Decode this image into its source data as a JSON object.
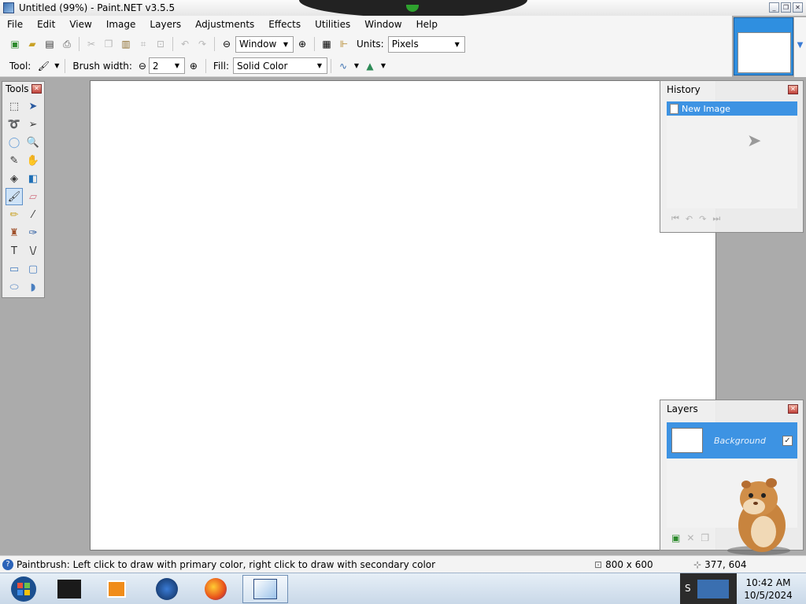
{
  "window": {
    "title": "Untitled (99%) - Paint.NET v3.5.5"
  },
  "menu": [
    "File",
    "Edit",
    "View",
    "Image",
    "Layers",
    "Adjustments",
    "Effects",
    "Utilities",
    "Window",
    "Help"
  ],
  "toolbar": {
    "zoom_value": "Window",
    "units_label": "Units:",
    "units_value": "Pixels",
    "tool_label": "Tool:",
    "brush_width_label": "Brush width:",
    "brush_width_value": "2",
    "fill_label": "Fill:",
    "fill_value": "Solid Color"
  },
  "tools_panel": {
    "title": "Tools",
    "selected": "paintbrush-tool"
  },
  "history": {
    "title": "History",
    "items": [
      "New Image"
    ]
  },
  "layers": {
    "title": "Layers",
    "items": [
      {
        "name": "Background",
        "visible": true
      }
    ]
  },
  "status": {
    "hint": "Paintbrush: Left click to draw with primary color, right click to draw with secondary color",
    "image_size": "800 x 600",
    "cursor_pos": "377, 604"
  },
  "taskbar": {
    "time": "10:42 AM",
    "date": "10/5/2024"
  },
  "colors": {
    "accent": "#3d93e3",
    "canvas": "#ffffff",
    "workspace": "#ababab"
  }
}
